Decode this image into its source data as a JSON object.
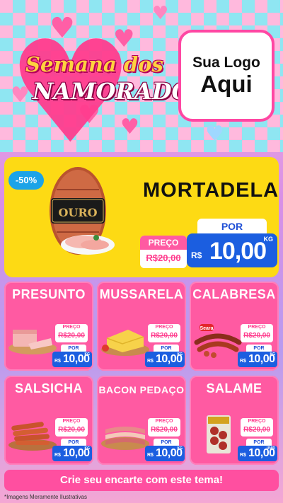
{
  "header": {
    "title_line1": "Semana dos",
    "title_line2": "NAMORADOS",
    "logo_line1": "Sua Logo",
    "logo_line2": "Aqui"
  },
  "featured": {
    "discount": "-50%",
    "brand": "OURO",
    "name": "MORTADELA",
    "preco_label": "PREÇO",
    "old_price": "R$20,00",
    "por_label": "POR",
    "currency": "R$",
    "price": "10,00",
    "unit": "KG"
  },
  "products": [
    {
      "name": "PRESUNTO",
      "preco_label": "PREÇO",
      "old_price": "R$20,00",
      "por_label": "POR",
      "currency": "R$",
      "price": "10,00",
      "unit": "KG"
    },
    {
      "name": "MUSSARELA",
      "preco_label": "PREÇO",
      "old_price": "R$20,00",
      "por_label": "POR",
      "currency": "R$",
      "price": "10,00",
      "unit": "KG"
    },
    {
      "name": "CALABRESA",
      "preco_label": "PREÇO",
      "old_price": "R$20,00",
      "por_label": "POR",
      "currency": "R$",
      "price": "10,00",
      "unit": "KG",
      "brand": "Seara"
    },
    {
      "name": "SALSICHA",
      "preco_label": "PREÇO",
      "old_price": "R$20,00",
      "por_label": "POR",
      "currency": "R$",
      "price": "10,00",
      "unit": "KG"
    },
    {
      "name": "BACON PEDAÇO",
      "preco_label": "PREÇO",
      "old_price": "R$20,00",
      "por_label": "POR",
      "currency": "R$",
      "price": "10,00",
      "unit": "KG"
    },
    {
      "name": "SALAME",
      "preco_label": "PREÇO",
      "old_price": "R$20,00",
      "por_label": "POR",
      "currency": "R$",
      "price": "10,00",
      "unit": "UNID"
    }
  ],
  "footer": {
    "cta": "Crie seu encarte com este tema!",
    "disclaimer": "*Imagens Meramente Ilustrativas"
  },
  "colors": {
    "pink": "#ff5aa2",
    "yellow": "#fdda14",
    "blue": "#1b5ee0",
    "cyan": "#8fe6f2"
  }
}
